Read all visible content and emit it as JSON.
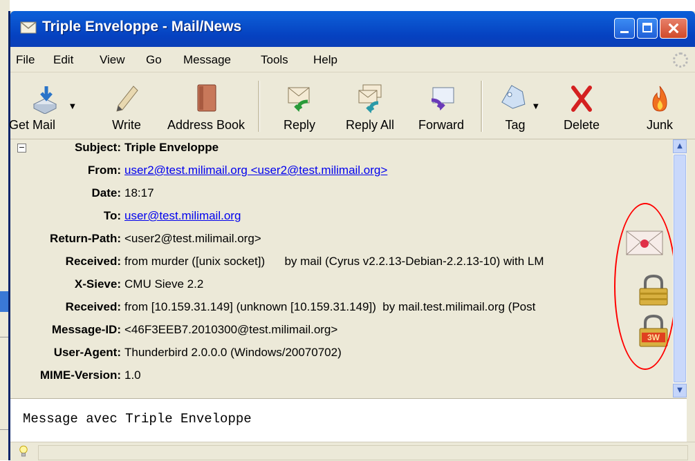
{
  "window": {
    "title": "Triple Enveloppe - Mail/News"
  },
  "menu": [
    "File",
    "Edit",
    "View",
    "Go",
    "Message",
    "Tools",
    "Help"
  ],
  "toolbar": [
    {
      "label": "Get Mail",
      "icon": "get-mail-icon"
    },
    {
      "label": "Write",
      "icon": "pencil-icon"
    },
    {
      "label": "Address Book",
      "icon": "address-book-icon"
    },
    {
      "label": "Reply",
      "icon": "reply-icon"
    },
    {
      "label": "Reply All",
      "icon": "reply-all-icon"
    },
    {
      "label": "Forward",
      "icon": "forward-icon"
    },
    {
      "label": "Tag",
      "icon": "tag-icon"
    },
    {
      "label": "Delete",
      "icon": "delete-icon"
    },
    {
      "label": "Junk",
      "icon": "junk-icon"
    }
  ],
  "headers": [
    {
      "key": "Subject:",
      "value": "Triple Enveloppe",
      "bold": true
    },
    {
      "key": "From:",
      "value": "user2@test.milimail.org <user2@test.milimail.org>",
      "link": true
    },
    {
      "key": "Date:",
      "value": "18:17"
    },
    {
      "key": "To:",
      "value": "user@test.milimail.org",
      "link": true
    },
    {
      "key": "Return-Path:",
      "value": "<user2@test.milimail.org>"
    },
    {
      "key": "Received:",
      "value": "from murder ([unix socket])      by mail (Cyrus v2.2.13-Debian-2.2.13-10) with LM"
    },
    {
      "key": "X-Sieve:",
      "value": "CMU Sieve 2.2"
    },
    {
      "key": "Received:",
      "value": "from [10.159.31.149] (unknown [10.159.31.149])  by mail.test.milimail.org (Post"
    },
    {
      "key": "Message-ID:",
      "value": "<46F3EEB7.2010300@test.milimail.org>"
    },
    {
      "key": "User-Agent:",
      "value": "Thunderbird 2.0.0.0 (Windows/20070702)"
    },
    {
      "key": "MIME-Version:",
      "value": "1.0"
    }
  ],
  "security_icons": [
    "signed-envelope-icon",
    "padlock-icon",
    "padlock-3w-icon"
  ],
  "security_badge": "3W",
  "message_body": "Message avec Triple Enveloppe",
  "colors": {
    "titlebar": "#0b58d2",
    "link": "#0000ee",
    "highlight_oval": "#ff0000"
  }
}
